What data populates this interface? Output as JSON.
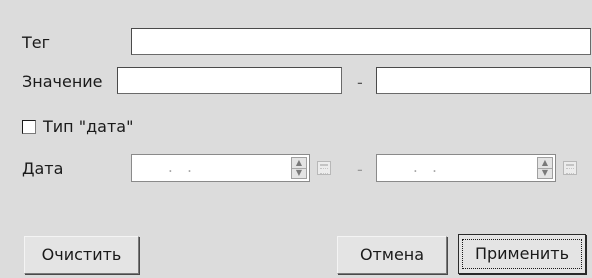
{
  "labels": {
    "tag": "Тег",
    "value": "Значение",
    "date_type": "Тип \"дата\"",
    "date": "Дата",
    "range_sep": "-"
  },
  "fields": {
    "tag_value": "",
    "value_from": "",
    "value_to": "",
    "date_from_separator": ".   .",
    "date_to_separator": ".   ."
  },
  "checkbox": {
    "date_type_checked": false
  },
  "buttons": {
    "clear": "Очистить",
    "cancel": "Отмена",
    "apply": "Применить"
  },
  "icons": {
    "spin_up": "▲",
    "spin_down": "▼"
  },
  "colors": {
    "dialog_bg": "#dcdcdc",
    "field_bg": "#ffffff"
  }
}
